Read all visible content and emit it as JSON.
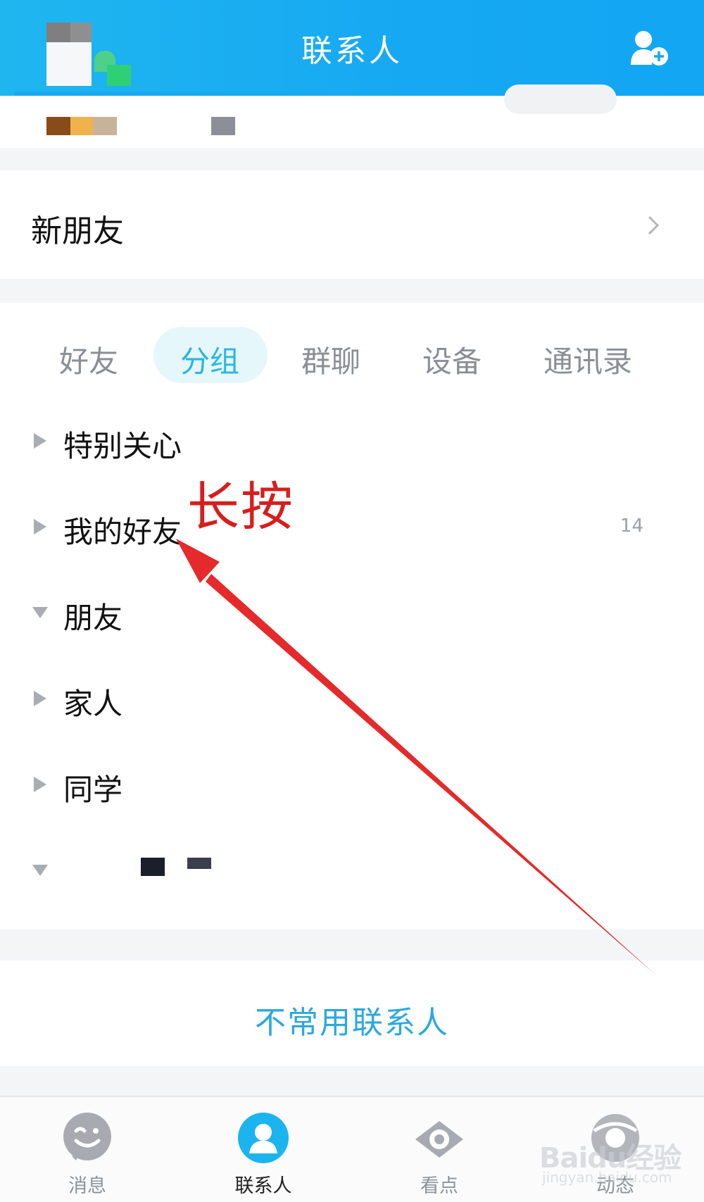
{
  "header": {
    "title": "联系人",
    "add_contact_icon": "add-contact-icon"
  },
  "new_friends": {
    "label": "新朋友"
  },
  "tabs": [
    {
      "label": "好友"
    },
    {
      "label": "分组",
      "active": true
    },
    {
      "label": "群聊"
    },
    {
      "label": "设备"
    },
    {
      "label": "通讯录"
    }
  ],
  "groups": [
    {
      "name": "特别关心",
      "expanded": false,
      "count": ""
    },
    {
      "name": "我的好友",
      "expanded": false,
      "count": "14"
    },
    {
      "name": "朋友",
      "expanded": true,
      "count": ""
    },
    {
      "name": "家人",
      "expanded": false,
      "count": ""
    },
    {
      "name": "同学",
      "expanded": false,
      "count": ""
    },
    {
      "name": "",
      "expanded": true,
      "count": ""
    }
  ],
  "infrequent": {
    "label": "不常用联系人"
  },
  "bottom_nav": [
    {
      "label": "消息",
      "icon": "message-icon"
    },
    {
      "label": "联系人",
      "icon": "contacts-icon",
      "active": true
    },
    {
      "label": "看点",
      "icon": "watch-icon"
    },
    {
      "label": "动态",
      "icon": "feed-icon"
    }
  ],
  "annotation": {
    "text": "长按"
  },
  "watermark": {
    "text": "Baidu经验",
    "sub": "jingyan.baidu.com"
  },
  "colors": {
    "header": "#16a8f2",
    "active_tab": "#2ab6e6",
    "annotation": "#d81d1d"
  }
}
